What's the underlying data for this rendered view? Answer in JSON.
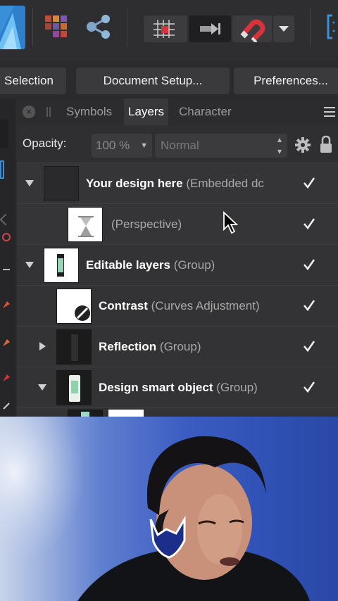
{
  "toolbar": {
    "icons": [
      "affinity-photo-logo",
      "live-projects-icon",
      "share-icon",
      "snapping-grid-icon",
      "transfer-icon",
      "magnet-icon",
      "chevron-down-icon",
      "view-bracket-icon"
    ]
  },
  "buttons": {
    "selection": "Selection",
    "document_setup": "Document Setup...",
    "preferences": "Preferences..."
  },
  "panel": {
    "tabs": [
      "Symbols",
      "Layers",
      "Character"
    ],
    "active_tab": "Layers",
    "opacity_label": "Opacity:",
    "opacity_value": "100 %",
    "blend_mode": "Normal"
  },
  "layers": [
    {
      "name": "Your design here",
      "type": "(Embedded dc",
      "checked": true,
      "expanded": true
    },
    {
      "name": "",
      "type": "(Perspective)",
      "checked": true
    },
    {
      "name": "Editable layers",
      "type": "(Group)",
      "checked": true,
      "expanded": true
    },
    {
      "name": "Contrast",
      "type": "(Curves Adjustment)",
      "checked": true
    },
    {
      "name": "Reflection",
      "type": "(Group)",
      "checked": true,
      "expanded": false
    },
    {
      "name": "Design smart object",
      "type": "(Group)",
      "checked": true,
      "expanded": true
    }
  ],
  "colors": {
    "panel_bg": "#333335",
    "toolbar_bg": "#2e2e30",
    "accent_blue": "#3a8fd9",
    "magnet_red": "#d9323a"
  }
}
